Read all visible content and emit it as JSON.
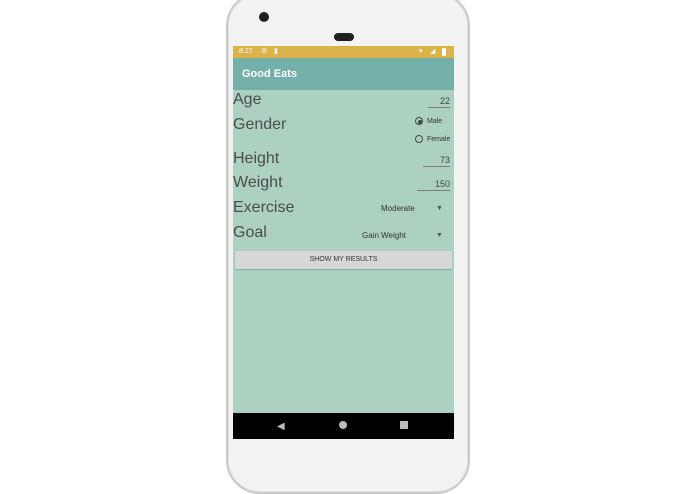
{
  "status_bar": {
    "time": "8:27",
    "icons": [
      "gear-icon",
      "lock-icon",
      "wifi-icon",
      "signal-icon",
      "battery-icon"
    ]
  },
  "app_bar": {
    "title": "Good Eats"
  },
  "form": {
    "age_label": "Age",
    "age_value": "22",
    "gender_label": "Gender",
    "gender_options": [
      "Male",
      "Female"
    ],
    "gender_selected": "Male",
    "height_label": "Height",
    "height_value": "73",
    "weight_label": "Weight",
    "weight_value": "150",
    "exercise_label": "Exercise",
    "exercise_value": "Moderate",
    "goal_label": "Goal",
    "goal_value": "Gain Weight"
  },
  "actions": {
    "show_results_label": "SHOW MY RESULTS"
  },
  "colors": {
    "screen_bg": "#acd1c1",
    "appbar_bg": "#74b0a9",
    "statusbar_bg": "#dcb24a",
    "navbar_bg": "#000000",
    "button_bg": "#d7d7d7"
  }
}
